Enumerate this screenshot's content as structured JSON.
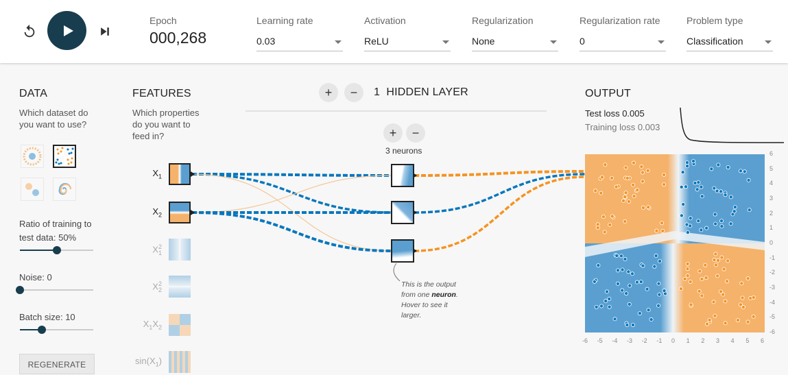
{
  "toolbar": {
    "epoch_label": "Epoch",
    "epoch_value": "000,268",
    "fields": [
      {
        "label": "Learning rate",
        "value": "0.03"
      },
      {
        "label": "Activation",
        "value": "ReLU"
      },
      {
        "label": "Regularization",
        "value": "None"
      },
      {
        "label": "Regularization rate",
        "value": "0"
      },
      {
        "label": "Problem type",
        "value": "Classification"
      }
    ]
  },
  "data_panel": {
    "title": "DATA",
    "subtitle_line1": "Which dataset do",
    "subtitle_line2": "you want to use?",
    "ratio_label": "Ratio of training to",
    "ratio_label2": "test data:  50%",
    "ratio_value": 0.5,
    "noise_label": "Noise:  0",
    "noise_value": 0,
    "batch_label": "Batch size:  10",
    "batch_value": 0.3,
    "regenerate_label": "REGENERATE"
  },
  "features_panel": {
    "title": "FEATURES",
    "subtitle_line1": "Which properties",
    "subtitle_line2": "do you want to",
    "subtitle_line3": "feed in?",
    "features": [
      {
        "label": "X",
        "sub": "1",
        "sup": "",
        "active": true
      },
      {
        "label": "X",
        "sub": "2",
        "sup": "",
        "active": true
      },
      {
        "label": "X",
        "sub": "1",
        "sup": "2",
        "active": false
      },
      {
        "label": "X",
        "sub": "2",
        "sup": "2",
        "active": false
      },
      {
        "label": "X",
        "sub": "1",
        "sup": "",
        "label2": "X",
        "sub2": "2",
        "active": false
      },
      {
        "label": "sin(X",
        "sub": "1",
        "sup": "",
        "suffix": ")",
        "active": false
      }
    ]
  },
  "network": {
    "hidden_layer_count": "1",
    "hidden_layer_label": "HIDDEN LAYER",
    "plus": "+",
    "minus": "−",
    "neurons_label": "3 neurons",
    "annotation_part1": "This is the output from one ",
    "annotation_bold": "neuron",
    "annotation_part2": ". Hover to see it larger."
  },
  "output_panel": {
    "title": "OUTPUT",
    "test_loss_label": "Test loss ",
    "test_loss_value": "0.005",
    "training_loss_label": "Training loss ",
    "training_loss_value": "0.003",
    "axis_ticks": [
      "-6",
      "-5",
      "-4",
      "-3",
      "-2",
      "-1",
      "0",
      "1",
      "2",
      "3",
      "4",
      "5",
      "6"
    ]
  },
  "colors": {
    "orange": "#f59322",
    "blue": "#0877bd",
    "region_orange": "#f5b26b",
    "region_blue": "#5a9fd0",
    "dark": "#183d4e"
  }
}
